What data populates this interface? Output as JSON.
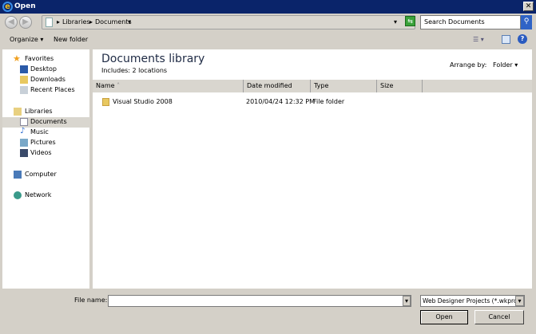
{
  "window": {
    "title": "Open",
    "close": "✕"
  },
  "nav": {
    "back": "◀",
    "forward": "▶",
    "breadcrumb": [
      "Libraries",
      "Documents"
    ],
    "search_placeholder": "Search Documents"
  },
  "toolbar": {
    "organize": "Organize",
    "new_folder": "New folder"
  },
  "sidebar": {
    "groups": [
      {
        "label": "Favorites",
        "items": [
          "Desktop",
          "Downloads",
          "Recent Places"
        ]
      },
      {
        "label": "Libraries",
        "items": [
          "Documents",
          "Music",
          "Pictures",
          "Videos"
        ]
      },
      {
        "label": "Computer",
        "items": []
      },
      {
        "label": "Network",
        "items": []
      }
    ],
    "selected": "Documents"
  },
  "main": {
    "title": "Documents library",
    "includes_label": "Includes:",
    "includes_value": "2 locations",
    "arrange_label": "Arrange by:",
    "arrange_value": "Folder",
    "columns": [
      "Name",
      "Date modified",
      "Type",
      "Size"
    ],
    "rows": [
      {
        "name": "Visual Studio 2008",
        "date": "2010/04/24 12:32 PM",
        "type": "File folder",
        "size": ""
      }
    ]
  },
  "footer": {
    "file_name_label": "File name:",
    "file_name_value": "",
    "filter": "Web Designer Projects (*.wkprc",
    "open": "Open",
    "cancel": "Cancel"
  },
  "colors": {
    "titlebar": "#0a246a",
    "chrome": "#d4d0c8"
  }
}
